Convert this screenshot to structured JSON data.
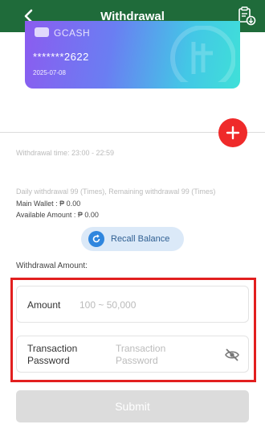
{
  "header": {
    "title": "Withdrawal",
    "back_icon": "back-arrow-icon",
    "record_icon": "record-download-icon",
    "bg_color": "#1f6b3a"
  },
  "card": {
    "brand": "GCASH",
    "account": "*******2622",
    "date": "2025-07-08"
  },
  "add_icon": "plus-icon",
  "withdrawal_time": "Withdrawal time:   23:00 - 22:59",
  "daily_info": "Daily withdrawal 99 (Times), Remaining withdrawal 99 (Times)",
  "main_wallet": "Main Wallet : ₱ 0.00",
  "available_amount": "Available Amount : ₱ 0.00",
  "recall_balance": "Recall Balance",
  "amount_section_label": "Withdrawal Amount:",
  "amount_field": {
    "label": "Amount",
    "placeholder": "100 ~ 50,000",
    "value": ""
  },
  "password_field": {
    "label": "Transaction Password",
    "placeholder": "Transaction Password",
    "value": "",
    "eye_icon": "eye-off-icon"
  },
  "submit_label": "Submit",
  "accent_red": "#ef2a2a",
  "highlight_red": "#e21f1f"
}
